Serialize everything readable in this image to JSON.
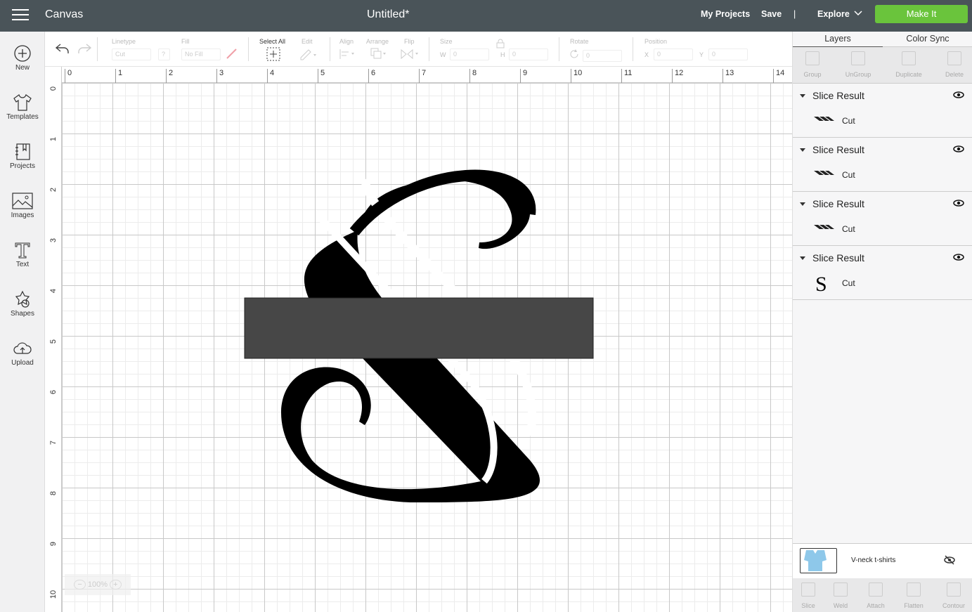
{
  "topbar": {
    "app": "Canvas",
    "title": "Untitled*",
    "my_projects": "My Projects",
    "save": "Save",
    "divider": "|",
    "explore": "Explore",
    "make_it": "Make It",
    "make_it_color": "#6ac43c"
  },
  "sidebar": [
    {
      "label": "New",
      "icon": "plus-circle-icon"
    },
    {
      "label": "Templates",
      "icon": "tshirt-icon"
    },
    {
      "label": "Projects",
      "icon": "notebook-icon"
    },
    {
      "label": "Images",
      "icon": "image-icon"
    },
    {
      "label": "Text",
      "icon": "text-icon"
    },
    {
      "label": "Shapes",
      "icon": "shapes-icon"
    },
    {
      "label": "Upload",
      "icon": "cloud-upload-icon"
    }
  ],
  "toolbar": {
    "linetype": "Linetype",
    "linetype_value": "Cut",
    "help": "?",
    "fill": "Fill",
    "fill_value": "No Fill",
    "select_all": "Select All",
    "edit": "Edit",
    "align": "Align",
    "arrange": "Arrange",
    "flip": "Flip",
    "size": "Size",
    "w": "W",
    "w_value": "0",
    "h": "H",
    "h_value": "0",
    "rotate": "Rotate",
    "rotate_value": "0",
    "position": "Position",
    "x": "X",
    "x_value": "0",
    "y": "Y",
    "y_value": "0"
  },
  "ruler": {
    "top": [
      "0",
      "1",
      "2",
      "3",
      "4",
      "5",
      "6",
      "7",
      "8",
      "9",
      "10",
      "11",
      "12",
      "13",
      "14"
    ],
    "left": [
      "0",
      "1",
      "2",
      "3",
      "4",
      "5",
      "6",
      "7",
      "8",
      "9",
      "10"
    ]
  },
  "zoom": "100%",
  "panel": {
    "tabs": [
      "Layers",
      "Color Sync"
    ],
    "actions": [
      "Group",
      "UnGroup",
      "Duplicate",
      "Delete"
    ],
    "layers": [
      {
        "name": "Slice Result",
        "type": "Cut"
      },
      {
        "name": "Slice Result",
        "type": "Cut"
      },
      {
        "name": "Slice Result",
        "type": "Cut"
      },
      {
        "name": "Slice Result",
        "type": "Cut"
      }
    ],
    "mat": "V-neck t-shirts",
    "bottom_actions": [
      "Slice",
      "Weld",
      "Attach",
      "Flatten",
      "Contour"
    ]
  }
}
